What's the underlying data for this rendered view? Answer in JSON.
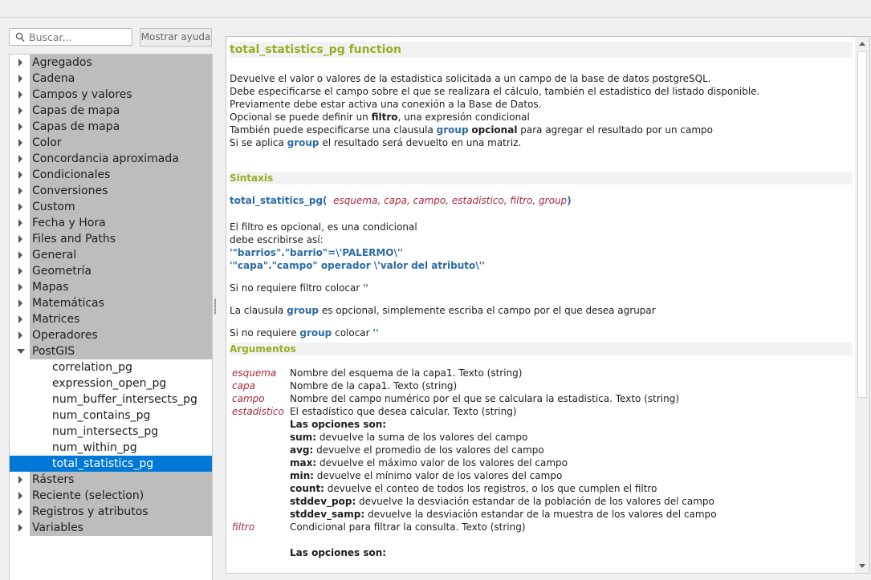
{
  "search": {
    "placeholder": "Buscar..."
  },
  "help_button": "Mostrar ayuda",
  "tree": {
    "groups_before": [
      "Agregados",
      "Cadena",
      "Campos y valores",
      "Capas de mapa",
      "Capas de mapa",
      "Color",
      "Concordancia aproximada",
      "Condicionales",
      "Conversiones",
      "Custom",
      "Fecha y Hora",
      "Files and Paths",
      "General",
      "Geometría",
      "Mapas",
      "Matemáticas",
      "Matrices",
      "Operadores"
    ],
    "open_group": "PostGIS",
    "children": [
      "correlation_pg",
      "expression_open_pg",
      "num_buffer_intersects_pg",
      "num_contains_pg",
      "num_intersects_pg",
      "num_within_pg",
      "total_statistics_pg"
    ],
    "selected_child": "total_statistics_pg",
    "groups_after": [
      "Rásters",
      "Reciente (selection)",
      "Registros y atributos",
      "Variables"
    ]
  },
  "help": {
    "title": "total_statistics_pg function",
    "desc": {
      "l1": "Devuelve el valor o valores de la estadistica solicitada a un campo de la base de datos postgreSQL.",
      "l2": "Debe especificarse el campo sobre el que se realizara el cálculo, también el estadistico del listado disponible.",
      "l3": "Previamente debe estar activa una conexión a la Base de Datos.",
      "l4a": "Opcional se puede definir un ",
      "l4b": "filtro",
      "l4c": ", una expresión condicional",
      "l5a": "También puede especificarse una clausula ",
      "l5b": "group",
      "l5c": "opcional",
      "l5d": " para agregar el resultado por un campo",
      "l6a": "Si se aplica ",
      "l6b": "group",
      "l6c": " el resultado será devuelto en una matriz."
    },
    "syntax_heading": "Sintaxis",
    "syntax": {
      "fn": "total_statitics_pg(",
      "params": "esquema, capa, campo, estadistico, filtro, group",
      "close": ")"
    },
    "notes": {
      "n1": "El filtro es opcional, es una condicional",
      "n2": "debe escribirse así:",
      "n3": "'\"barrios\".\"barrio\"=\\'PALERMO\\''",
      "n4": "'\"capa\".\"campo\" operador \\'valor del atributo\\''",
      "n5": "Si no requiere filtro colocar ''",
      "n6a": "La clausula ",
      "n6b": "group",
      "n6c": " es opcional, simplemente escriba el campo por el que desea agrupar",
      "n7a": "Si no requiere ",
      "n7b": "group",
      "n7c": " colocar ",
      "n7d": "''"
    },
    "args_heading": "Argumentos",
    "args": [
      {
        "name": "esquema",
        "desc": "Nombre del esquema de la capa1. Texto (string)"
      },
      {
        "name": "capa",
        "desc": "Nombre de la capa1. Texto (string)"
      },
      {
        "name": "campo",
        "desc": "Nombre del campo numérico por el que se calculara la estadistica. Texto (string)"
      },
      {
        "name": "estadistico",
        "desc": "El estadístico que desea calcular. Texto (string)"
      }
    ],
    "options_heading": "Las opciones son:",
    "options": [
      {
        "k": "sum:",
        "v": " devuelve la suma de los valores del campo"
      },
      {
        "k": "avg:",
        "v": " devuelve el promedio de los valores del campo"
      },
      {
        "k": "max:",
        "v": " devuelve el máximo valor de los valores del campo"
      },
      {
        "k": "min:",
        "v": " devuelve el mínimo valor de los valores del campo"
      },
      {
        "k": "count:",
        "v": " devuelve el conteo de todos los registros, o los que cumplen el filtro"
      },
      {
        "k": "stddev_pop:",
        "v": " devuelve la desviación estandar de la población de los valores del campo"
      },
      {
        "k": "stddev_samp:",
        "v": " devuelve la desviación estandar de la muestra de los valores del campo"
      }
    ],
    "filtro_arg": {
      "name": "filtro",
      "desc": "Condicional para filtrar la consulta. Texto (string)"
    },
    "trailing": "Las opciones son:"
  }
}
